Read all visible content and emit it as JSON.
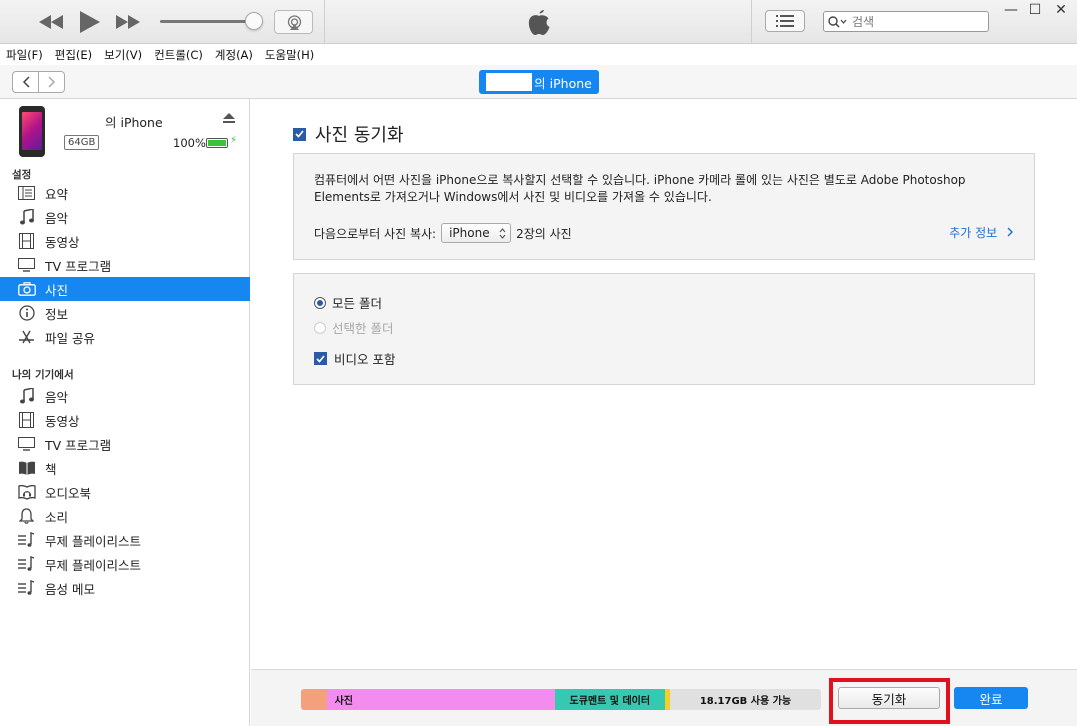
{
  "menu": [
    "파일(F)",
    "편집(E)",
    "보기(V)",
    "컨트롤(C)",
    "계정(A)",
    "도움말(H)"
  ],
  "search": {
    "placeholder": "검색"
  },
  "navbar": {
    "device_label": "의 iPhone"
  },
  "device": {
    "name": "의 iPhone",
    "capacity": "64GB",
    "battery": "100%",
    "battery_level": 1.0
  },
  "sidebar": {
    "settings_title": "설정",
    "settings": [
      {
        "label": "요약",
        "icon": "summary-icon"
      },
      {
        "label": "음악",
        "icon": "music-icon"
      },
      {
        "label": "동영상",
        "icon": "film-icon"
      },
      {
        "label": "TV 프로그램",
        "icon": "tv-icon"
      },
      {
        "label": "사진",
        "icon": "camera-icon",
        "active": true
      },
      {
        "label": "정보",
        "icon": "info-icon"
      },
      {
        "label": "파일 공유",
        "icon": "app-store-icon"
      }
    ],
    "device_title": "나의 기기에서",
    "device_items": [
      {
        "label": "음악",
        "icon": "music-icon"
      },
      {
        "label": "동영상",
        "icon": "film-icon"
      },
      {
        "label": "TV 프로그램",
        "icon": "tv-icon"
      },
      {
        "label": "책",
        "icon": "book-icon"
      },
      {
        "label": "오디오북",
        "icon": "audiobook-icon"
      },
      {
        "label": "소리",
        "icon": "bell-icon"
      },
      {
        "label": "무제 플레이리스트",
        "icon": "playlist-icon"
      },
      {
        "label": "무제 플레이리스트",
        "icon": "playlist-icon"
      },
      {
        "label": "음성 메모",
        "icon": "playlist-icon"
      }
    ]
  },
  "main": {
    "sync_title": "사진 동기화",
    "description": "컴퓨터에서 어떤 사진을 iPhone으로 복사할지 선택할 수 있습니다. iPhone 카메라 롤에 있는 사진은 별도로 Adobe Photoshop Elements로 가져오거나 Windows에서 사진 및 비디오를 가져올 수 있습니다.",
    "copy_from_label": "다음으로부터 사진 복사:",
    "copy_from_value": "iPhone",
    "photo_count": "2장의 사진",
    "more_info": "추가 정보",
    "options": {
      "all_folders": "모든 폴더",
      "selected_folders": "선택한 폴더",
      "include_videos": "비디오 포함"
    }
  },
  "storage": {
    "segments": [
      {
        "label": "",
        "color": "#f4a07a",
        "fraction": 0.05
      },
      {
        "label": "사진",
        "color": "#f48cf0",
        "fraction": 0.43
      },
      {
        "label": "도큐멘트 및 데이터",
        "color": "#34c9b0",
        "fraction": 0.215
      },
      {
        "label": "",
        "color": "#f4cf2a",
        "fraction": 0.01
      },
      {
        "label": "18.17GB 사용 가능",
        "color": "#e0e0e0",
        "fraction": 0.295
      }
    ]
  },
  "buttons": {
    "sync": "동기화",
    "done": "완료"
  },
  "colors": {
    "accent": "#1686f0",
    "highlight": "#e0101e"
  }
}
